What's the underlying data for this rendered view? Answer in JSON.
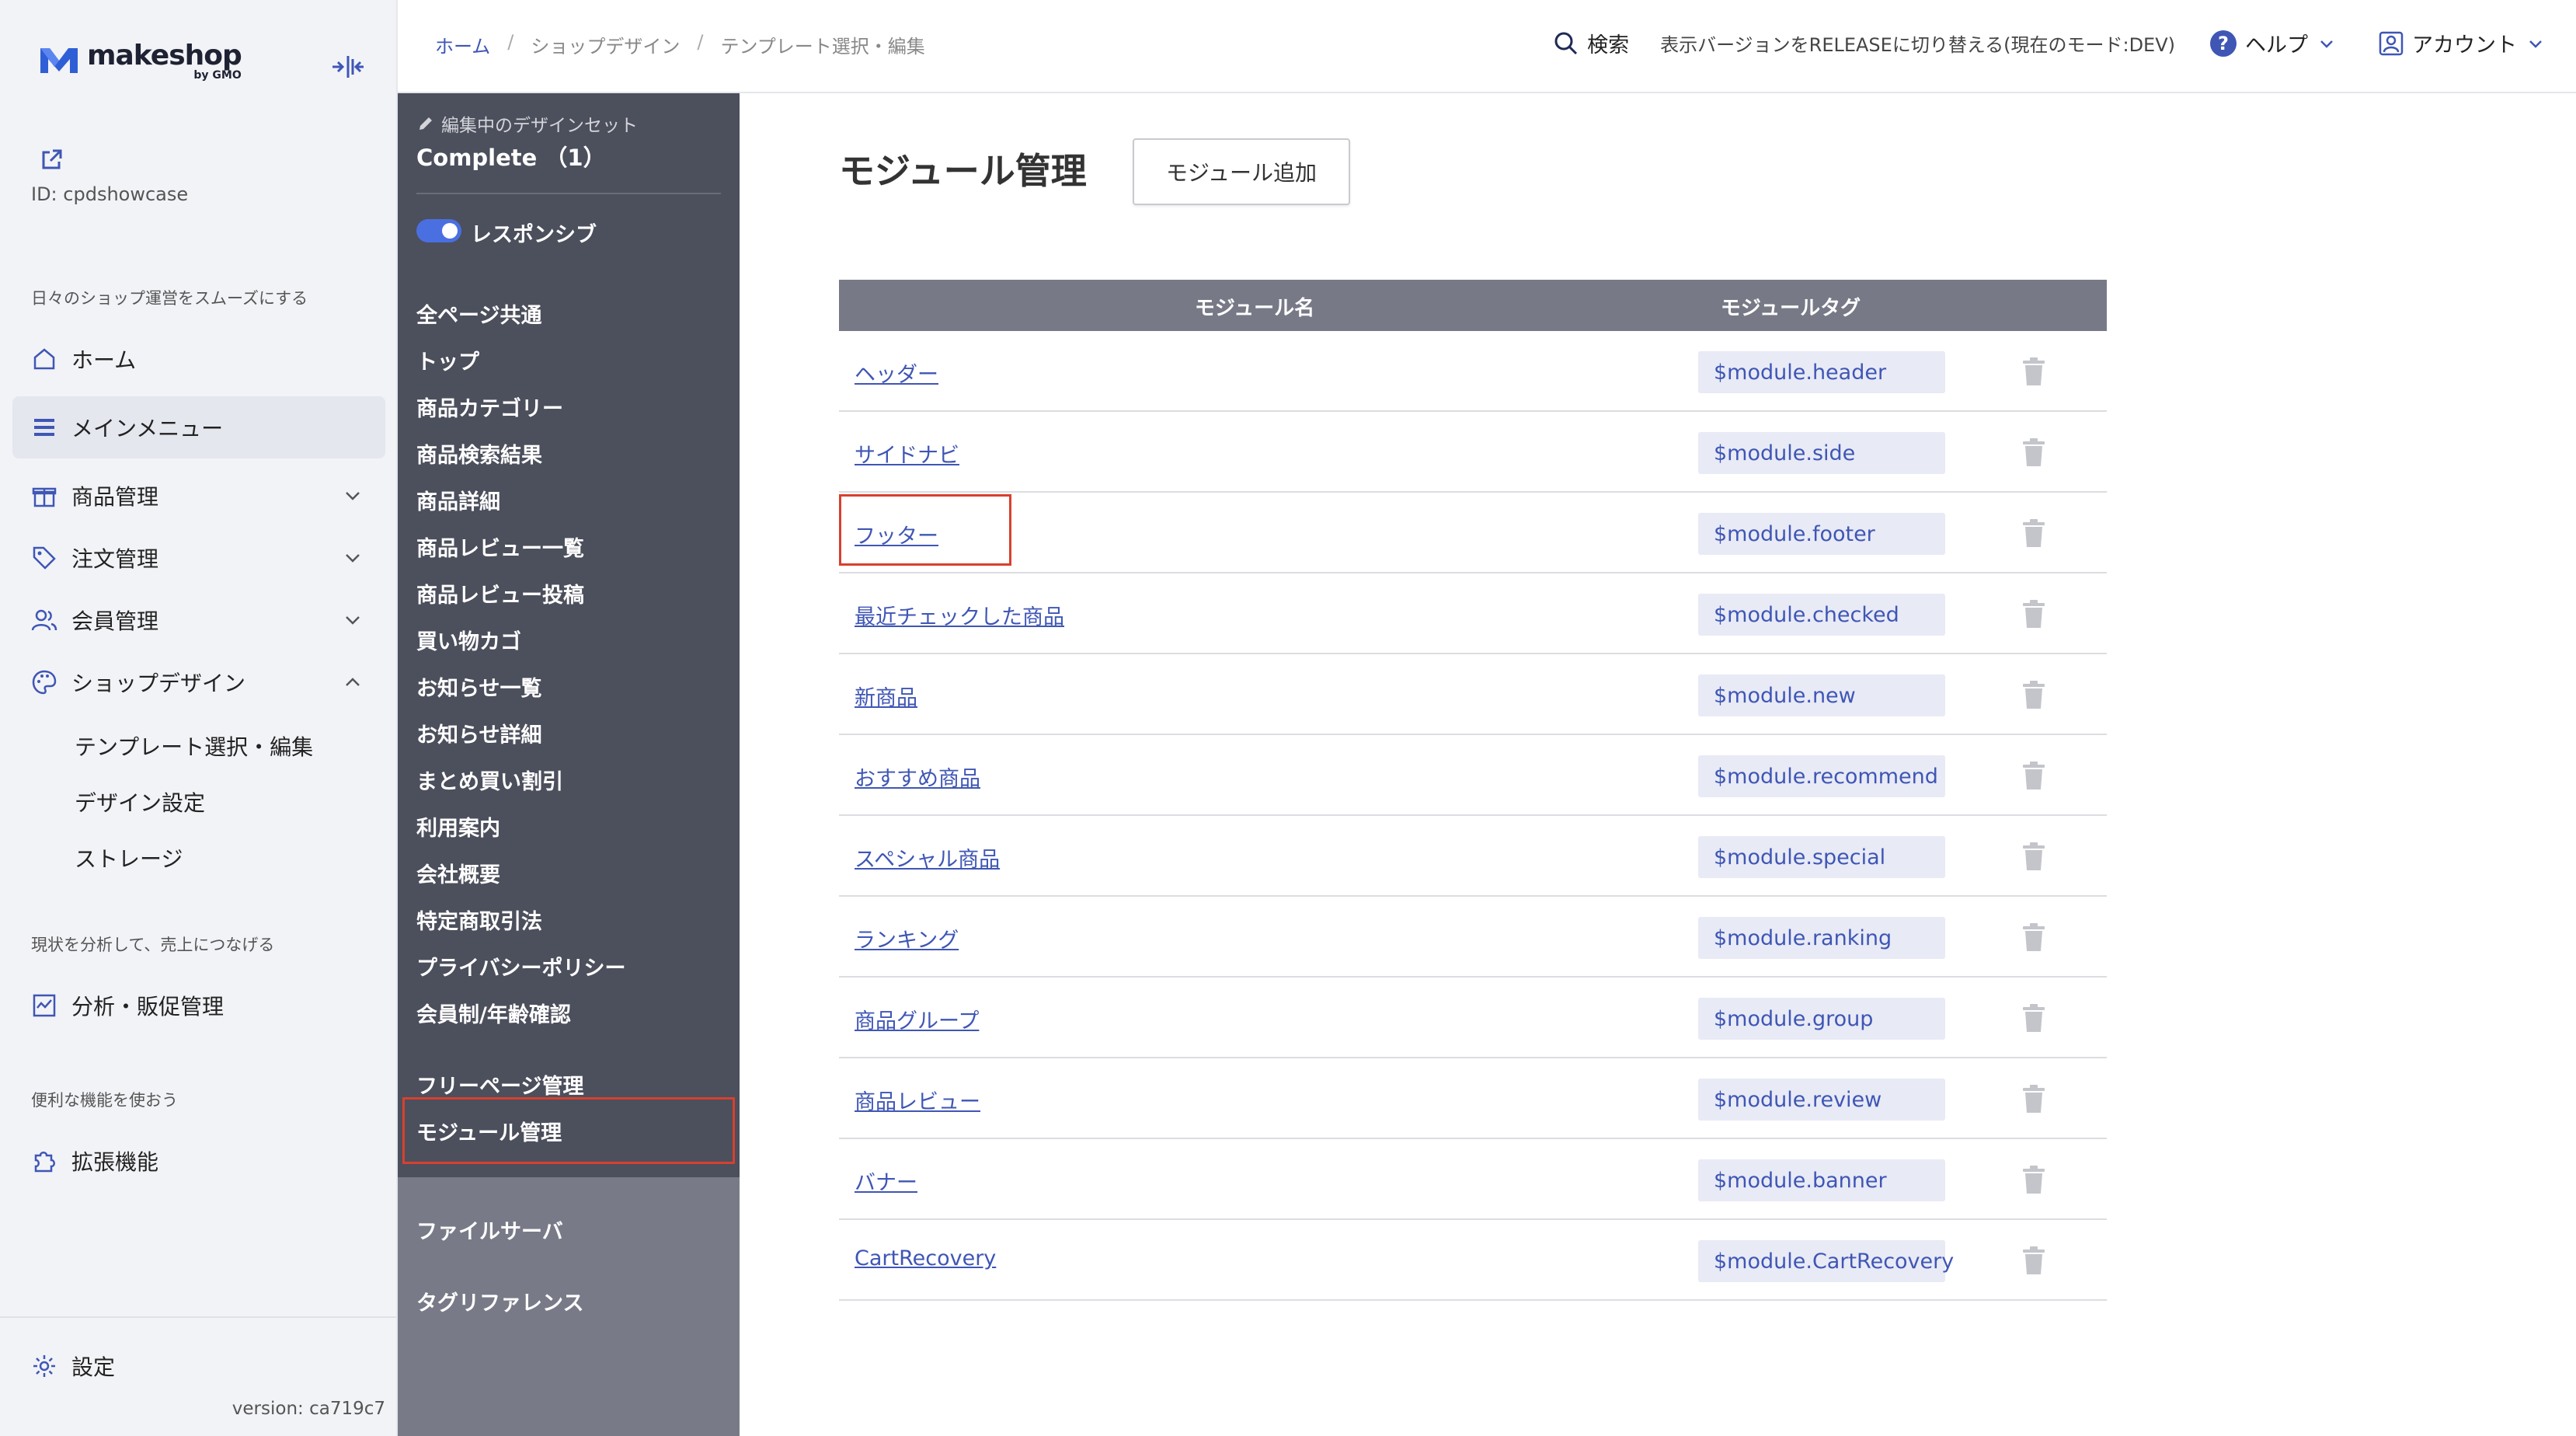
{
  "app": {
    "logo_text": "makeshop",
    "logo_sub": "by GMO",
    "shop_id": "ID: cpdshowcase",
    "version": "version: ca719c7"
  },
  "sidebar": {
    "section1": "日々のショップ運営をスムーズにする",
    "section2": "現状を分析して、売上につなげる",
    "section3": "便利な機能を使おう",
    "items": [
      {
        "label": "ホーム",
        "icon": "home-icon"
      },
      {
        "label": "メインメニュー",
        "icon": "menu-icon"
      },
      {
        "label": "商品管理",
        "icon": "gift-icon"
      },
      {
        "label": "注文管理",
        "icon": "tag-icon"
      },
      {
        "label": "会員管理",
        "icon": "users-icon"
      },
      {
        "label": "ショップデザイン",
        "icon": "palette-icon"
      }
    ],
    "design_sub": [
      "テンプレート選択・編集",
      "デザイン設定",
      "ストレージ"
    ],
    "analytics": "分析・販促管理",
    "extensions": "拡張機能",
    "settings": "設定"
  },
  "topbar": {
    "breadcrumb": [
      "ホーム",
      "ショップデザイン",
      "テンプレート選択・編集"
    ],
    "search": "検索",
    "mode_switch": "表示バージョンをRELEASEに切り替える(現在のモード:DEV)",
    "help": "ヘルプ",
    "account": "アカウント"
  },
  "design_panel": {
    "label": "編集中のデザインセット",
    "name": "Complete （1）",
    "responsive": "レスポンシブ",
    "pages": [
      "全ページ共通",
      "トップ",
      "商品カテゴリー",
      "商品検索結果",
      "商品詳細",
      "商品レビュー一覧",
      "商品レビュー投稿",
      "買い物カゴ",
      "お知らせ一覧",
      "お知らせ詳細",
      "まとめ買い割引",
      "利用案内",
      "会社概要",
      "特定商取引法",
      "プライバシーポリシー",
      "会員制/年齢確認"
    ],
    "free_page": "フリーページ管理",
    "module": "モジュール管理",
    "file_server": "ファイルサーバ",
    "tag_ref": "タグリファレンス"
  },
  "main": {
    "title": "モジュール管理",
    "add_button": "モジュール追加",
    "columns": [
      "モジュール名",
      "モジュールタグ"
    ],
    "rows": [
      {
        "name": "ヘッダー",
        "tag": "$module.header"
      },
      {
        "name": "サイドナビ",
        "tag": "$module.side"
      },
      {
        "name": "フッター",
        "tag": "$module.footer"
      },
      {
        "name": "最近チェックした商品",
        "tag": "$module.checked"
      },
      {
        "name": "新商品",
        "tag": "$module.new"
      },
      {
        "name": "おすすめ商品",
        "tag": "$module.recommend"
      },
      {
        "name": "スペシャル商品",
        "tag": "$module.special"
      },
      {
        "name": "ランキング",
        "tag": "$module.ranking"
      },
      {
        "name": "商品グループ",
        "tag": "$module.group"
      },
      {
        "name": "商品レビュー",
        "tag": "$module.review"
      },
      {
        "name": "バナー",
        "tag": "$module.banner"
      },
      {
        "name": "CartRecovery",
        "tag": "$module.CartRecovery"
      }
    ]
  },
  "colors": {
    "accent": "#3f56b5",
    "highlight": "#d8402e",
    "panel_dark": "#4c4f5c",
    "table_header": "#777a86"
  }
}
